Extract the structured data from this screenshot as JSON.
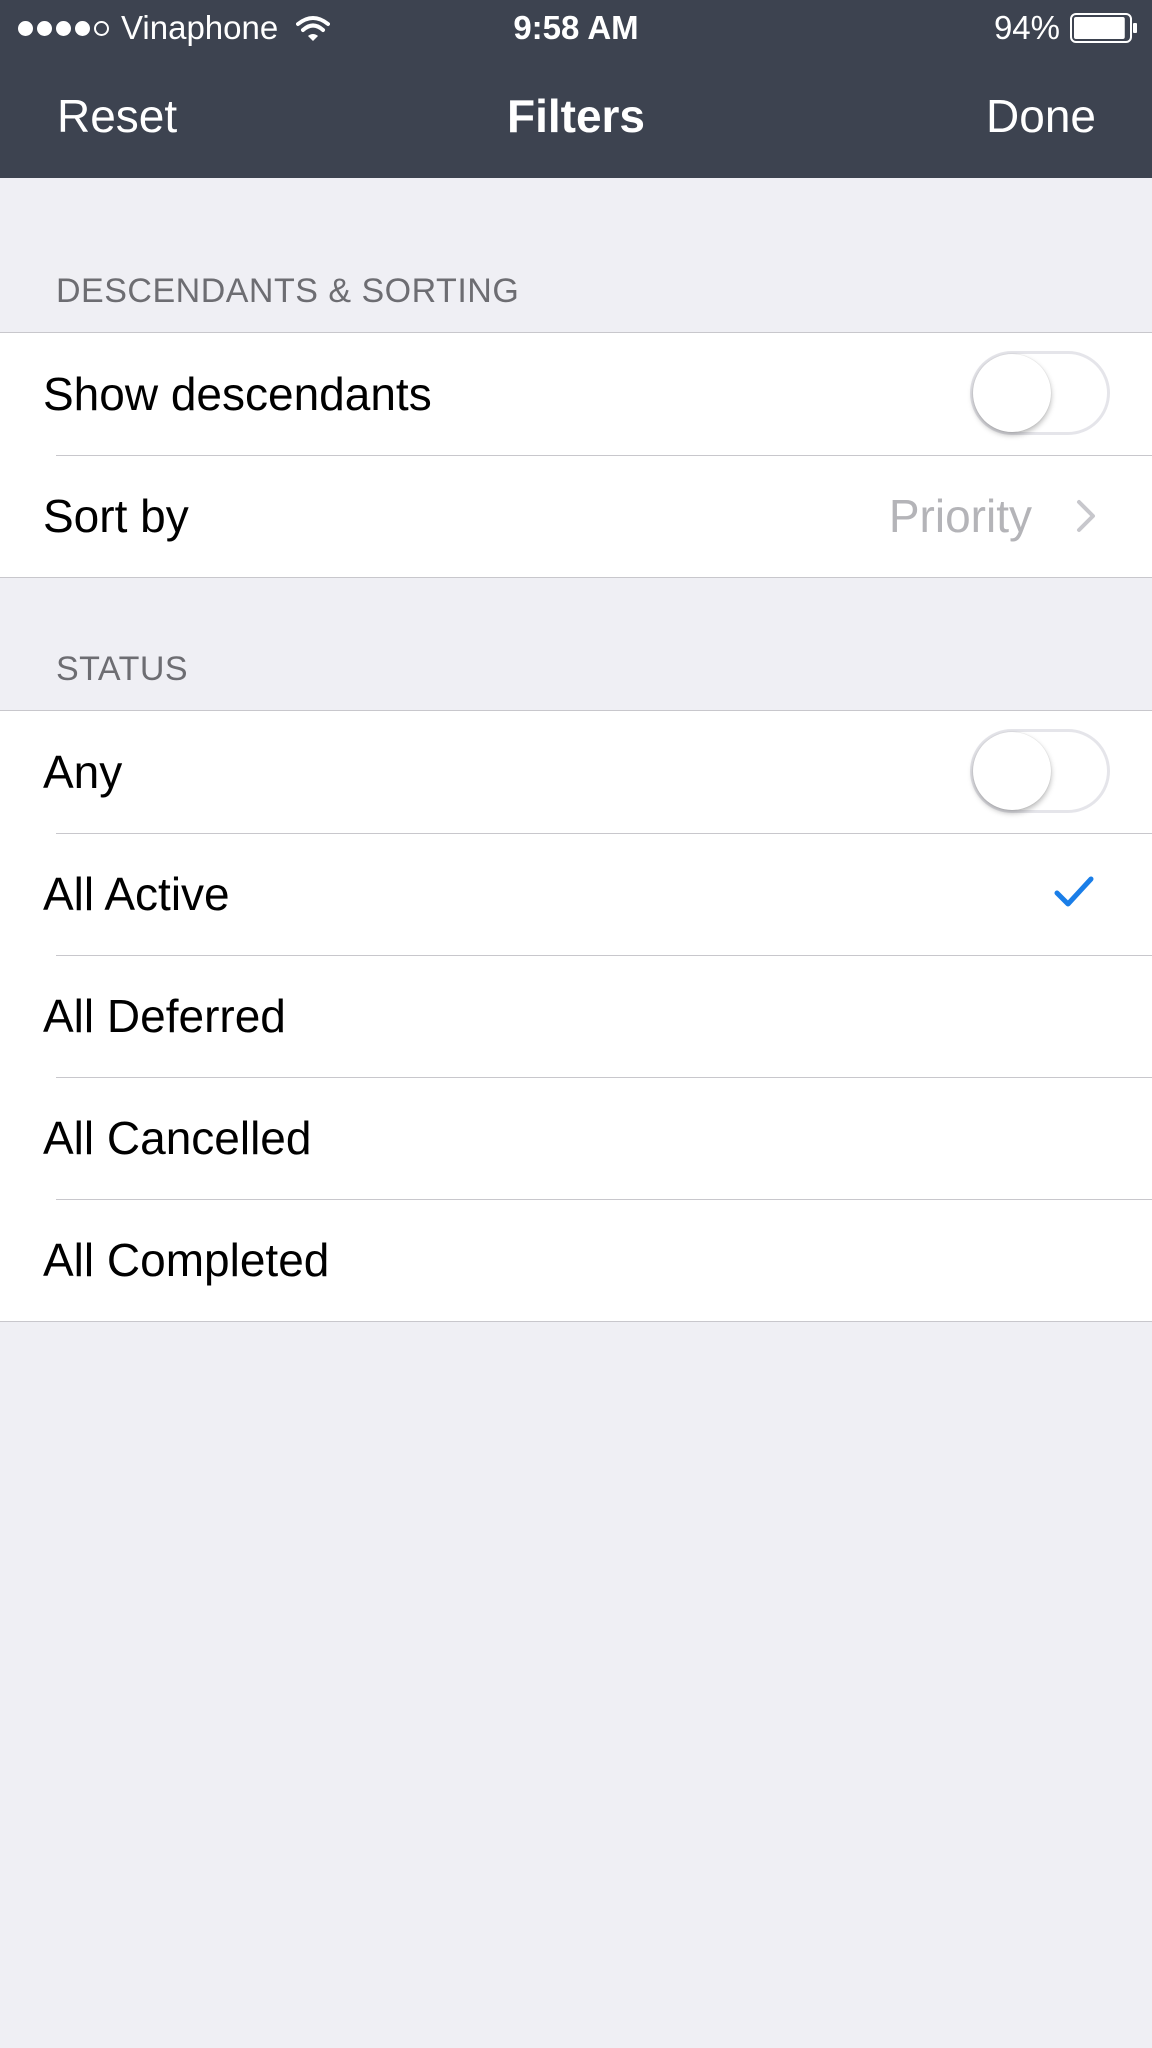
{
  "status_bar": {
    "carrier": "Vinaphone",
    "signal_bars_filled": 4,
    "signal_bars_total": 5,
    "time": "9:58 AM",
    "battery_percent": "94%",
    "battery_level": 0.94
  },
  "nav": {
    "left_label": "Reset",
    "title": "Filters",
    "right_label": "Done"
  },
  "sections": {
    "descendants": {
      "header": "DESCENDANTS & SORTING",
      "show_descendants_label": "Show descendants",
      "show_descendants_on": false,
      "sort_by_label": "Sort by",
      "sort_by_value": "Priority"
    },
    "status": {
      "header": "STATUS",
      "any_label": "Any",
      "any_on": false,
      "options": [
        {
          "label": "All Active",
          "checked": true
        },
        {
          "label": "All Deferred",
          "checked": false
        },
        {
          "label": "All Cancelled",
          "checked": false
        },
        {
          "label": "All Completed",
          "checked": false
        }
      ]
    }
  },
  "colors": {
    "bar_background": "#3d4350",
    "page_background": "#efeff4",
    "accent": "#1a7ee8",
    "secondary_text": "#b4b4b8"
  }
}
